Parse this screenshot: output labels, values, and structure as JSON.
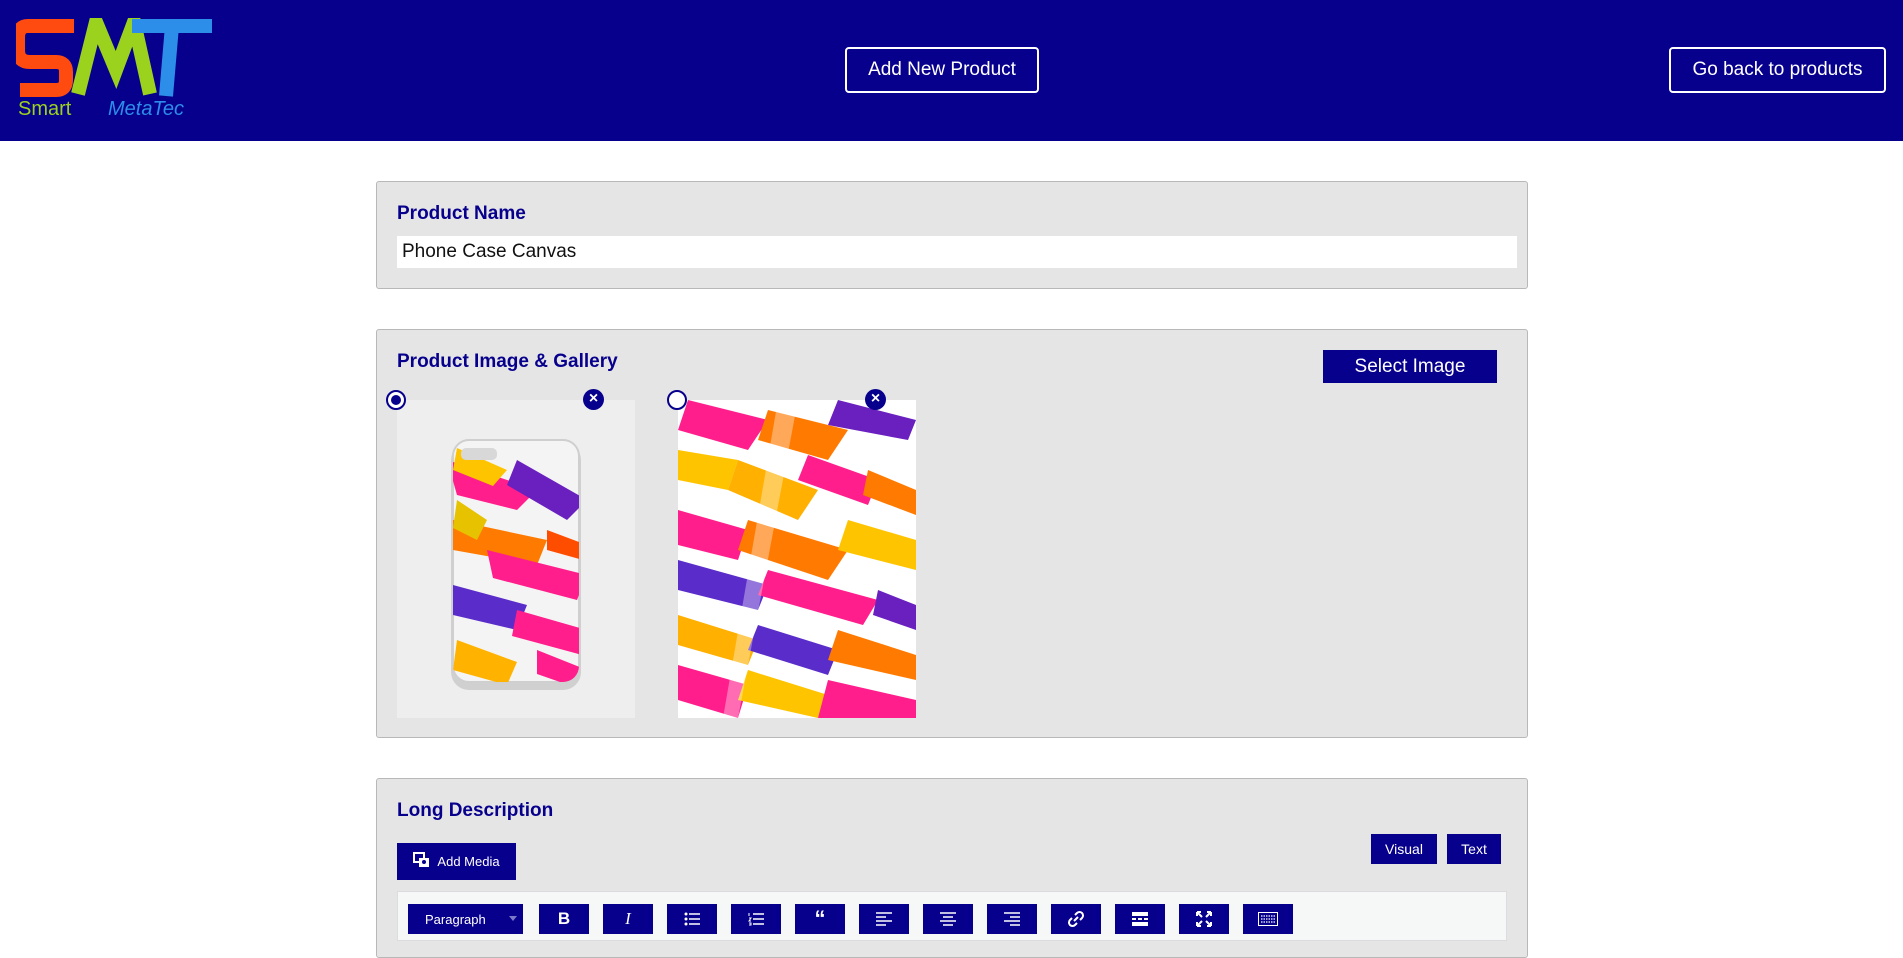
{
  "header": {
    "logo_text": "SMT",
    "logo_subtitle_1": "Smart",
    "logo_subtitle_2": "MetaTec",
    "add_new_label": "Add New Product",
    "go_back_label": "Go back to products",
    "bg_color": "#07008c"
  },
  "product_name": {
    "label": "Product Name",
    "value": "Phone Case Canvas"
  },
  "gallery": {
    "title": "Product Image & Gallery",
    "select_label": "Select Image",
    "images": [
      {
        "kind": "phone-case-mockup",
        "featured": true
      },
      {
        "kind": "abstract-canvas",
        "featured": false
      }
    ]
  },
  "description": {
    "title": "Long Description",
    "add_media_label": "Add Media",
    "visual_label": "Visual",
    "text_label": "Text",
    "paragraph_label": "Paragraph",
    "toolbar_icons": [
      "bold-icon",
      "italic-icon",
      "bullet-list-icon",
      "numbered-list-icon",
      "blockquote-icon",
      "align-left-icon",
      "align-center-icon",
      "align-right-icon",
      "link-icon",
      "read-more-icon",
      "fullscreen-icon",
      "toolbar-toggle-icon"
    ]
  },
  "colors": {
    "primary": "#07008c",
    "panel_bg": "#e5e5e5"
  }
}
